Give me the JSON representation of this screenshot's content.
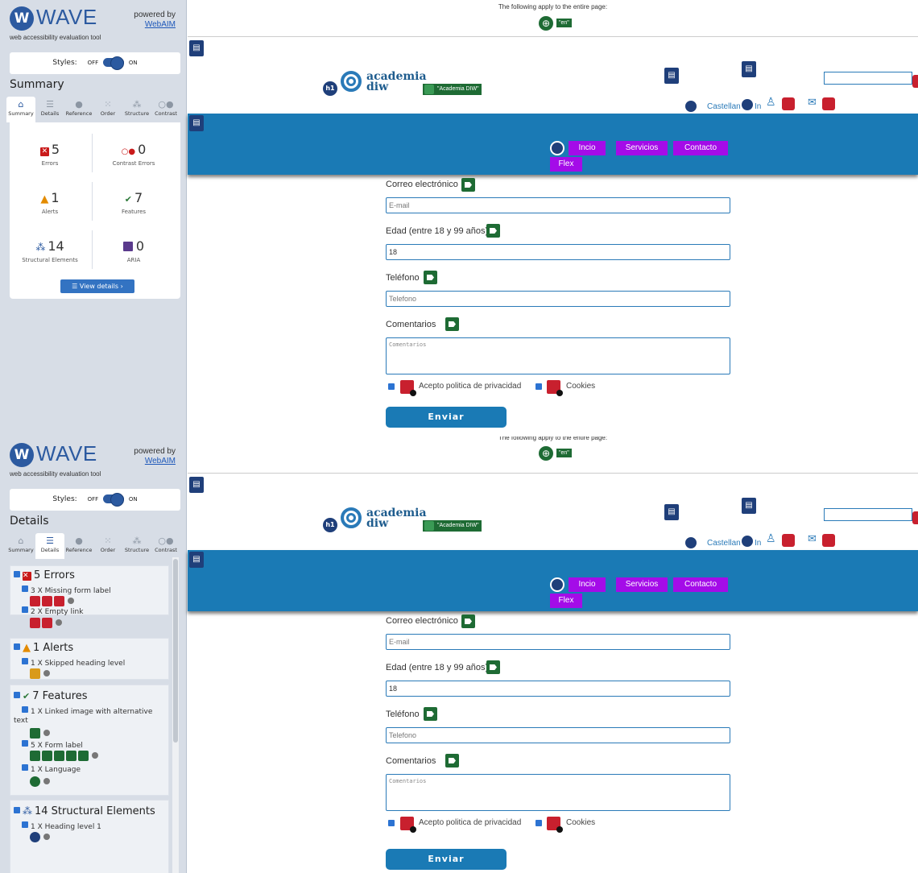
{
  "wave": {
    "logo_letter": "W",
    "brand": "WAVE",
    "tagline": "web accessibility evaluation tool",
    "powered_by": "powered by",
    "powered_link": "WebAIM",
    "styles_label": "Styles:",
    "styles_off": "OFF",
    "styles_on": "ON",
    "tabs": [
      {
        "label": "Summary",
        "icon": "home-icon"
      },
      {
        "label": "Details",
        "icon": "list-icon"
      },
      {
        "label": "Reference",
        "icon": "info-icon"
      },
      {
        "label": "Order",
        "icon": "order-icon"
      },
      {
        "label": "Structure",
        "icon": "structure-icon"
      },
      {
        "label": "Contrast",
        "icon": "contrast-icon"
      }
    ]
  },
  "summary": {
    "title": "Summary",
    "errors": {
      "count": "5",
      "label": "Errors"
    },
    "contrast": {
      "count": "0",
      "label": "Contrast Errors"
    },
    "alerts": {
      "count": "1",
      "label": "Alerts"
    },
    "features": {
      "count": "7",
      "label": "Features"
    },
    "structural": {
      "count": "14",
      "label": "Structural Elements"
    },
    "aria": {
      "count": "0",
      "label": "ARIA"
    },
    "view_details": "View details ›"
  },
  "details": {
    "title": "Details",
    "groups": [
      {
        "title": "5 Errors",
        "items": [
          "3 X Missing form label",
          "2 X Empty link"
        ]
      },
      {
        "title": "1 Alerts",
        "items": [
          "1 X Skipped heading level"
        ]
      },
      {
        "title": "7 Features",
        "items": [
          "1 X Linked image with alternative text",
          "5 X Form label",
          "1 X Language"
        ]
      },
      {
        "title": "14 Structural Elements",
        "items": [
          "1 X Heading level 1"
        ]
      }
    ]
  },
  "page": {
    "banner": "The following apply to the entire page:",
    "lang_tag": "\"en\"",
    "h1": "h1",
    "logo_line1": "academia",
    "logo_line2": "diw",
    "logo_alt": "\"Academia DIW\"",
    "lang_text": "Castellan",
    "lang_text2": "In",
    "menu": [
      "Incio",
      "Servicios",
      "Contacto",
      "Flex"
    ],
    "form": {
      "email_label": "Correo electrónico",
      "email_placeholder": "E-mail",
      "age_label": "Edad (entre 18 y 99 años)",
      "age_value": "18",
      "phone_label": "Teléfono",
      "phone_placeholder": "Telefono",
      "comments_label": "Comentarios",
      "comments_placeholder": "Comentarios",
      "privacy": "Acepto politica de privacidad",
      "cookies": "Cookies",
      "submit": "Enviar"
    }
  },
  "colors": {
    "wave_blue": "#2c5aa0",
    "nav_blue": "#1a7ab5",
    "menu_purple": "#a40ce8",
    "error_red": "#c8202e",
    "feature_green": "#1e6b34"
  }
}
